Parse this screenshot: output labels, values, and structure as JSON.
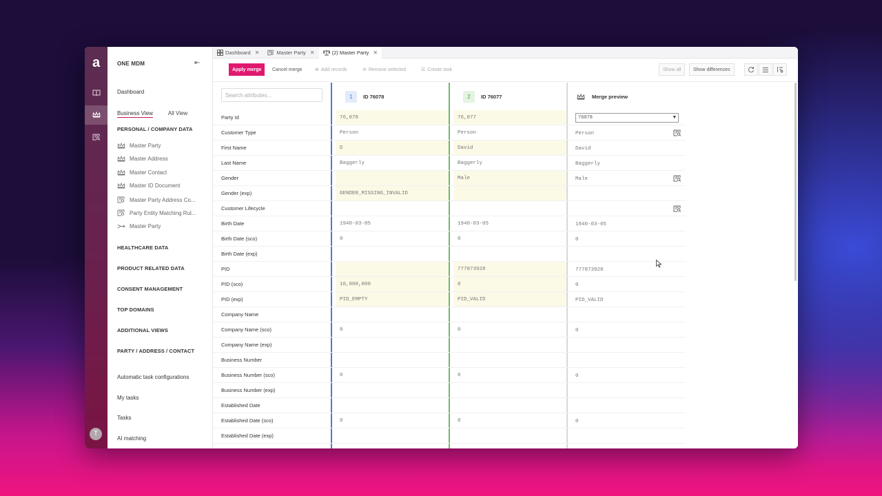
{
  "app": {
    "title": "ONE MDM",
    "logo": "a",
    "avatar_initial": "T",
    "accent": "#e0196f"
  },
  "rail_icons": [
    "book-icon",
    "crown-icon",
    "search-list-icon"
  ],
  "nav": {
    "dashboard": "Dashboard",
    "view_tabs": [
      "Business View",
      "All View"
    ],
    "section_personal": "PERSONAL / COMPANY DATA",
    "items": [
      {
        "label": "Master Party",
        "icon": "crown-icon"
      },
      {
        "label": "Master Address",
        "icon": "crown-icon"
      },
      {
        "label": "Master Contact",
        "icon": "crown-icon"
      },
      {
        "label": "Master ID Document",
        "icon": "crown-icon"
      },
      {
        "label": "Master Party Address Co...",
        "icon": "search-list-icon"
      },
      {
        "label": "Party Entity Matching Rul...",
        "icon": "search-list-icon"
      },
      {
        "label": "Master Party",
        "icon": "merge-icon"
      }
    ],
    "sections": [
      "HEALTHCARE DATA",
      "PRODUCT RELATED DATA",
      "CONSENT MANAGEMENT",
      "TOP DOMAINS",
      "ADDITIONAL VIEWS",
      "PARTY / ADDRESS / CONTACT"
    ],
    "links": [
      "Automatic task configurations",
      "My tasks",
      "Tasks",
      "AI matching"
    ]
  },
  "tabs": [
    {
      "label": "Dashboard",
      "icon": "dashboard-icon"
    },
    {
      "label": "Master Party",
      "icon": "search-list-icon"
    },
    {
      "label": "(2) Master Party",
      "icon": "scale-icon"
    }
  ],
  "toolbar": {
    "apply_merge": "Apply merge",
    "cancel_merge": "Cancel merge",
    "add_records": "Add records",
    "remove_selected": "Remove selected",
    "create_task": "Create task",
    "show_all": "Show all",
    "show_differences": "Show differences"
  },
  "grid": {
    "search_placeholder": "Search attributes...",
    "record1": {
      "num": "1",
      "id": "ID 76078",
      "color": "#4a78d6"
    },
    "record2": {
      "num": "2",
      "id": "ID 76077",
      "color": "#6cb86a"
    },
    "preview": {
      "title": "Merge preview",
      "selected": "76078"
    },
    "rows": [
      {
        "label": "Party Id",
        "r1": "76,078",
        "r2": "76,077",
        "m": "",
        "hl1": true,
        "hl2": true,
        "tool": false
      },
      {
        "label": "Customer Type",
        "r1": "Person",
        "r2": "Person",
        "m": "Person",
        "hl1": false,
        "hl2": false,
        "tool": true
      },
      {
        "label": "First Name",
        "r1": "D",
        "r2": "David",
        "m": "David",
        "hl1": true,
        "hl2": true,
        "tool": false
      },
      {
        "label": "Last Name",
        "r1": "Baggerly",
        "r2": "Baggerly",
        "m": "Baggerly",
        "hl1": false,
        "hl2": false,
        "tool": false
      },
      {
        "label": "Gender",
        "r1": "",
        "r2": "Male",
        "m": "Male",
        "hl1": true,
        "hl2": true,
        "tool": true
      },
      {
        "label": "Gender (exp)",
        "r1": "GENDER_MISSING_INVALID",
        "r2": "",
        "m": "",
        "hl1": true,
        "hl2": true,
        "tool": false
      },
      {
        "label": "Customer Lifecycle",
        "r1": "",
        "r2": "",
        "m": "",
        "hl1": false,
        "hl2": false,
        "tool": true
      },
      {
        "label": "Birth Date",
        "r1": "1940-03-05",
        "r2": "1940-03-05",
        "m": "1940-03-05",
        "hl1": false,
        "hl2": false,
        "tool": false
      },
      {
        "label": "Birth Date (sco)",
        "r1": "0",
        "r2": "0",
        "m": "0",
        "hl1": false,
        "hl2": false,
        "tool": false
      },
      {
        "label": "Birth Date (exp)",
        "r1": "",
        "r2": "",
        "m": "",
        "hl1": false,
        "hl2": false,
        "tool": false
      },
      {
        "label": "PID",
        "r1": "",
        "r2": "777873928",
        "m": "777873928",
        "hl1": true,
        "hl2": true,
        "tool": false
      },
      {
        "label": "PID (sco)",
        "r1": "10,000,000",
        "r2": "0",
        "m": "0",
        "hl1": true,
        "hl2": true,
        "tool": false
      },
      {
        "label": "PID (exp)",
        "r1": "PID_EMPTY",
        "r2": "PID_VALID",
        "m": "PID_VALID",
        "hl1": true,
        "hl2": true,
        "tool": false
      },
      {
        "label": "Company Name",
        "r1": "",
        "r2": "",
        "m": "",
        "hl1": false,
        "hl2": false,
        "tool": false
      },
      {
        "label": "Company Name (sco)",
        "r1": "0",
        "r2": "0",
        "m": "0",
        "hl1": false,
        "hl2": false,
        "tool": false
      },
      {
        "label": "Company Name (exp)",
        "r1": "",
        "r2": "",
        "m": "",
        "hl1": false,
        "hl2": false,
        "tool": false
      },
      {
        "label": "Business Number",
        "r1": "",
        "r2": "",
        "m": "",
        "hl1": false,
        "hl2": false,
        "tool": false
      },
      {
        "label": "Business Number (sco)",
        "r1": "0",
        "r2": "0",
        "m": "0",
        "hl1": false,
        "hl2": false,
        "tool": false
      },
      {
        "label": "Business Number (exp)",
        "r1": "",
        "r2": "",
        "m": "",
        "hl1": false,
        "hl2": false,
        "tool": false
      },
      {
        "label": "Established Date",
        "r1": "",
        "r2": "",
        "m": "",
        "hl1": false,
        "hl2": false,
        "tool": false
      },
      {
        "label": "Established Date (sco)",
        "r1": "0",
        "r2": "0",
        "m": "0",
        "hl1": false,
        "hl2": false,
        "tool": false
      },
      {
        "label": "Established Date (exp)",
        "r1": "",
        "r2": "",
        "m": "",
        "hl1": false,
        "hl2": false,
        "tool": false
      }
    ]
  }
}
